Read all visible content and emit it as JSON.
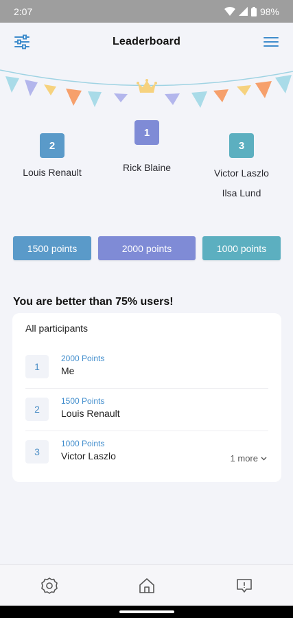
{
  "status": {
    "time": "2:07",
    "battery": "98%"
  },
  "appbar": {
    "title": "Leaderboard",
    "filter_icon": "sliders-icon",
    "menu_icon": "hamburger-menu-icon"
  },
  "podium": {
    "crown_icon": "crown-icon",
    "first": {
      "rank": "1",
      "names": [
        "Rick Blaine"
      ],
      "points": "2000 points",
      "color": "#7f8bd6"
    },
    "second": {
      "rank": "2",
      "names": [
        "Louis Renault"
      ],
      "points": "1500 points",
      "color": "#5a9ac9"
    },
    "third": {
      "rank": "3",
      "names": [
        "Victor Laszlo",
        "Ilsa Lund"
      ],
      "points": "1000 points",
      "color": "#5cafc0"
    }
  },
  "summary": "You are better than 75% users!",
  "participants": {
    "title": "All participants",
    "rows": [
      {
        "rank": "1",
        "points": "2000 Points",
        "name": "Me"
      },
      {
        "rank": "2",
        "points": "1500 Points",
        "name": "Louis Renault"
      },
      {
        "rank": "3",
        "points": "1000 Points",
        "name": "Victor Laszlo",
        "more": "1 more"
      }
    ]
  },
  "bottom_nav": [
    {
      "icon": "settings-gear-icon"
    },
    {
      "icon": "home-icon"
    },
    {
      "icon": "feedback-icon"
    }
  ],
  "colors": {
    "accent": "#3f8ccc",
    "background": "#f3f4f9"
  }
}
